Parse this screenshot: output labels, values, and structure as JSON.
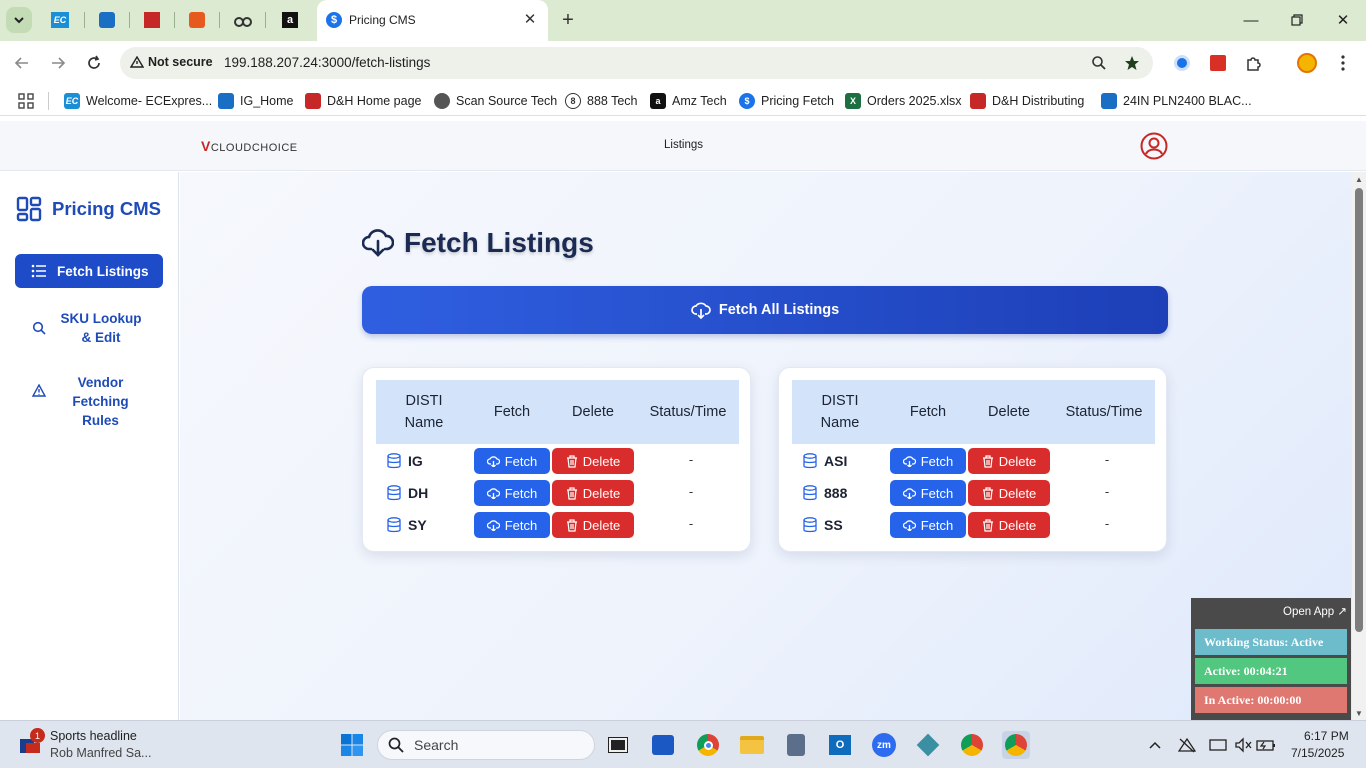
{
  "browser": {
    "active_tab_title": "Pricing CMS",
    "security_label": "Not secure",
    "url": "199.188.207.24:3000/fetch-listings",
    "bookmarks": [
      "Welcome- ECExpres...",
      "IG_Home",
      "D&H Home page",
      "Scan Source Tech",
      "888 Tech",
      "Amz Tech",
      "Pricing Fetch",
      "Orders 2025.xlsx",
      "D&H Distributing",
      "24IN PLN2400 BLAC..."
    ]
  },
  "app": {
    "logo_text_red": "V",
    "logo_text": "CLOUDCHOICE",
    "nav_listings": "Listings",
    "brand": "Pricing CMS",
    "sidebar": [
      {
        "label": "Fetch Listings",
        "icon": "list-icon",
        "active": true
      },
      {
        "label": "SKU Lookup & Edit",
        "icon": "search-icon",
        "active": false
      },
      {
        "label": "Vendor Fetching Rules",
        "icon": "warning-icon",
        "active": false
      }
    ],
    "page_title": "Fetch Listings",
    "fetch_all_label": "Fetch All Listings",
    "columns": [
      "DISTI Name",
      "Fetch",
      "Delete",
      "Status/Time"
    ],
    "fetch_label": "Fetch",
    "delete_label": "Delete",
    "tables": [
      {
        "rows": [
          {
            "name": "IG",
            "status": "-"
          },
          {
            "name": "DH",
            "status": "-"
          },
          {
            "name": "SY",
            "status": "-"
          }
        ]
      },
      {
        "rows": [
          {
            "name": "ASI",
            "status": "-"
          },
          {
            "name": "888",
            "status": "-"
          },
          {
            "name": "SS",
            "status": "-"
          }
        ]
      }
    ]
  },
  "widget": {
    "open_app": "Open App ↗",
    "working_status": "Working Status: Active",
    "active_time": "Active: 00:04:21",
    "inactive_time": "In Active: 00:00:00",
    "colors": {
      "status": "#6cbccc",
      "active": "#52c77f",
      "inactive": "#e07872"
    }
  },
  "taskbar": {
    "news_badge": "1",
    "news_title": "Sports headline",
    "news_sub": "Rob Manfred Sa...",
    "search_placeholder": "Search",
    "time": "6:17 PM",
    "date": "7/15/2025"
  },
  "colors": {
    "primary": "#2563eb",
    "danger": "#d92c2c",
    "brand": "#1e4bb8"
  }
}
